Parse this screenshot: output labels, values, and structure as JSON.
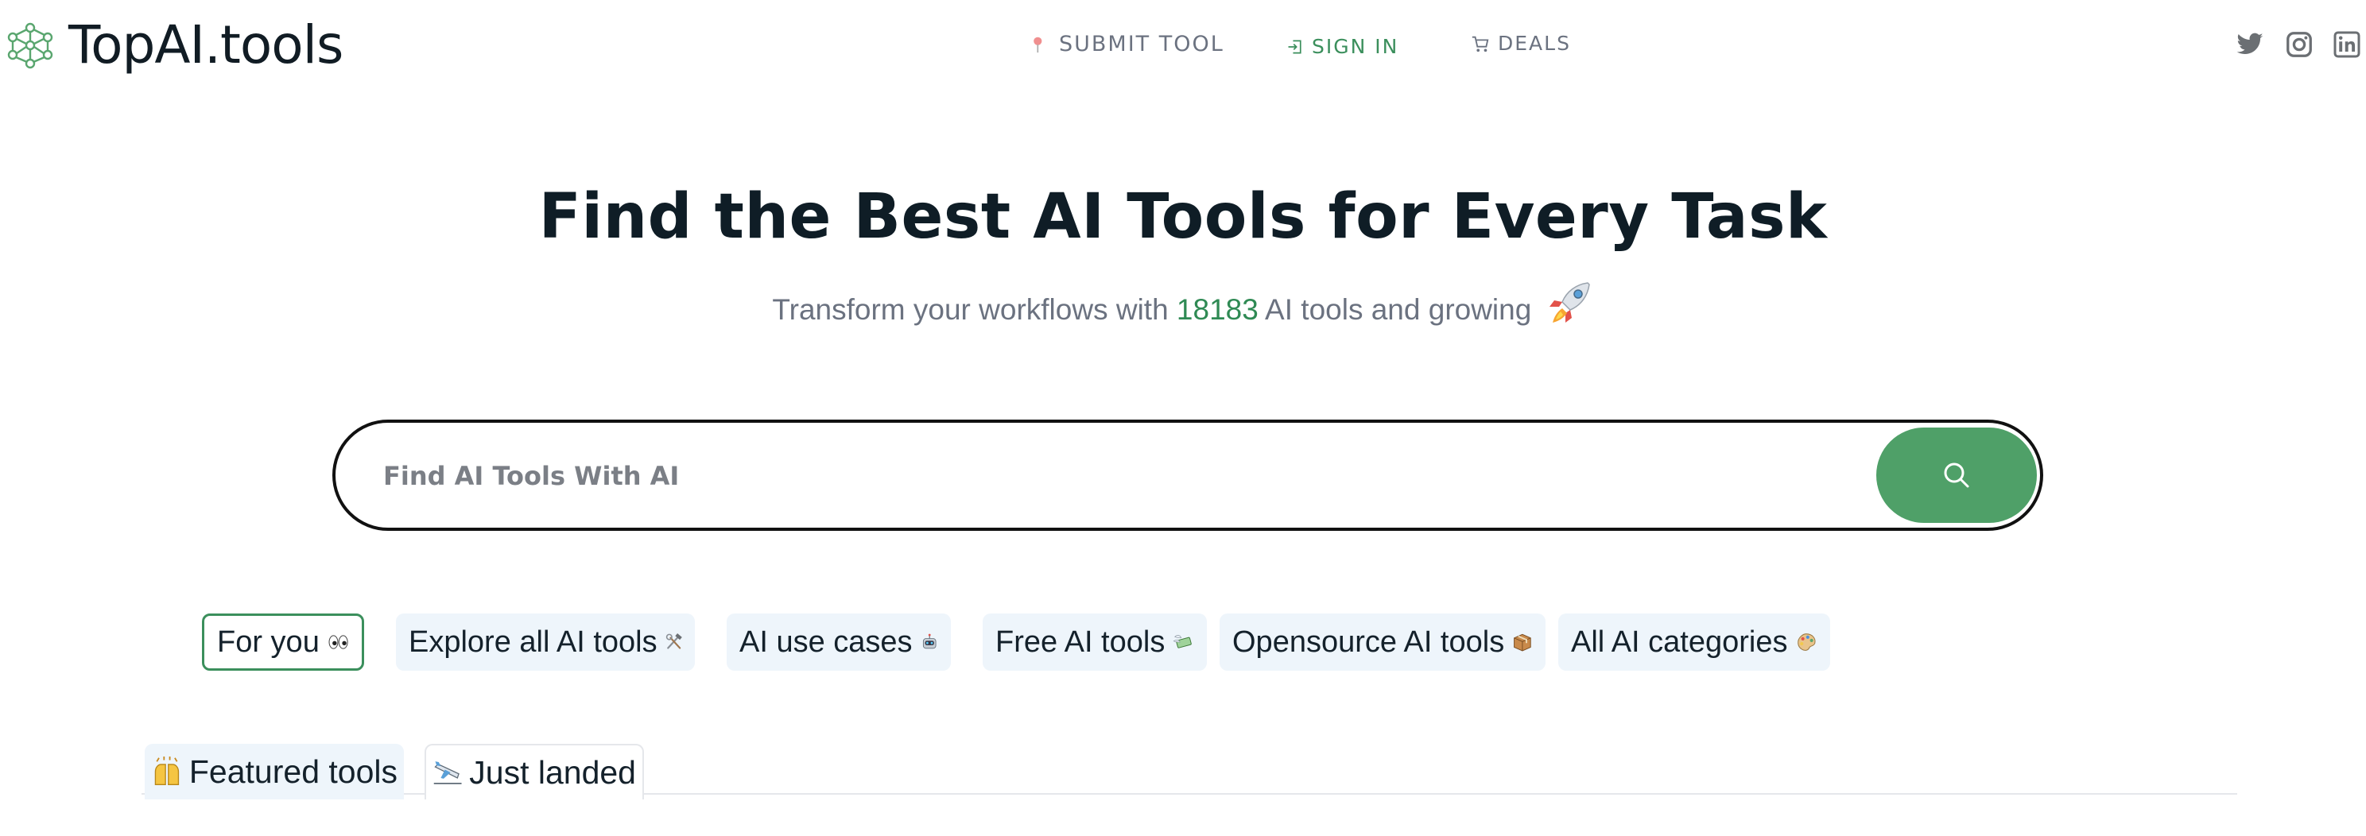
{
  "brand": {
    "name": "TopAI.tools",
    "accent": "#4fa068",
    "accent_text": "#2f8a54"
  },
  "nav": {
    "submit": "SUBMIT TOOL",
    "signin": "SIGN IN",
    "deals": "DEALS"
  },
  "social": [
    "twitter-icon",
    "instagram-icon",
    "linkedin-icon"
  ],
  "hero": {
    "title": "Find the Best AI Tools for Every Task",
    "sub_prefix": "Transform your workflows with ",
    "count": "18183",
    "sub_suffix": " AI tools and growing"
  },
  "search": {
    "placeholder": "Find AI Tools With AI"
  },
  "pills": [
    {
      "label": "For you",
      "icon": "eyes-emoji"
    },
    {
      "label": "Explore all AI tools",
      "icon": "hammer-wrench-emoji"
    },
    {
      "label": "AI use cases",
      "icon": "robot-emoji"
    },
    {
      "label": "Free AI tools",
      "icon": "money-wings-emoji"
    },
    {
      "label": "Opensource AI tools",
      "icon": "package-emoji"
    },
    {
      "label": "All AI categories",
      "icon": "palette-emoji"
    }
  ],
  "tabs": [
    {
      "label": "Featured tools",
      "icon": "raised-hands-emoji"
    },
    {
      "label": "Just landed",
      "icon": "airplane-arrival-emoji"
    }
  ]
}
